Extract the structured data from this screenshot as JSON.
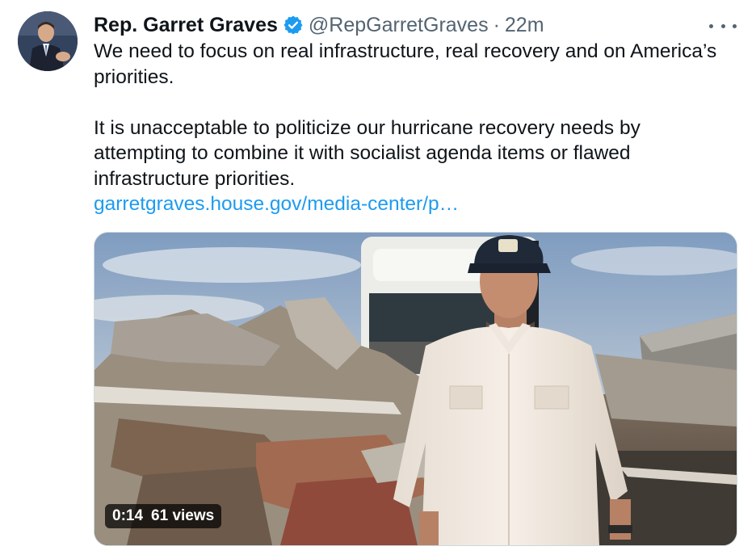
{
  "tweet": {
    "author_name": "Rep. Garret Graves",
    "handle": "@RepGarretGraves",
    "separator": "·",
    "timestamp": "22m",
    "paragraph_1": "We need to focus on real infrastructure, real recovery and on America’s priorities.",
    "paragraph_2": "It is unacceptable to politicize our hurricane recovery needs by attempting to combine it with socialist agenda items or flawed infrastructure priorities.",
    "link_text": "garretgraves.house.gov/media-center/p…",
    "icons": {
      "verified": "verified-badge-icon",
      "more": "more-options-icon"
    },
    "colors": {
      "link": "#1d9bf0",
      "verified": "#1d9bf0",
      "secondary_text": "#536471"
    }
  },
  "video": {
    "duration": "0:14",
    "views": "61 views"
  }
}
